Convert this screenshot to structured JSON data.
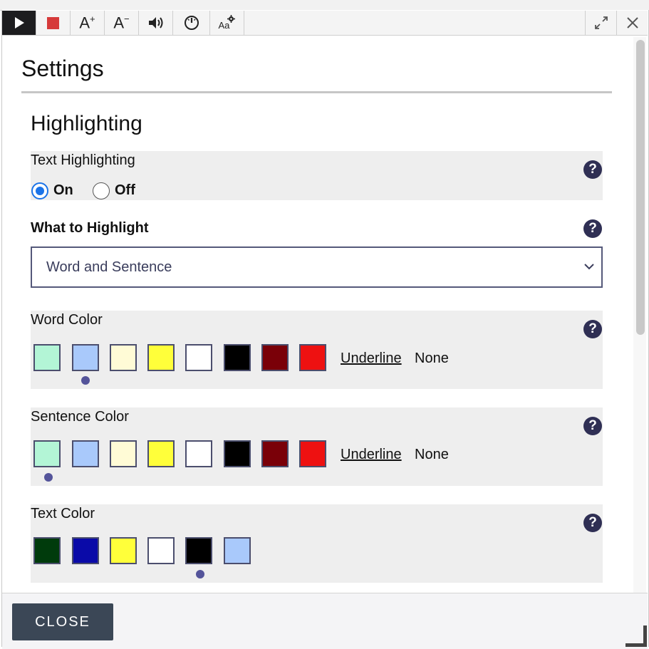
{
  "title": "Settings",
  "section": "Highlighting",
  "text_highlighting": {
    "label": "Text Highlighting",
    "options": [
      "On",
      "Off"
    ],
    "selected": "On"
  },
  "what_to_highlight": {
    "label": "What to Highlight",
    "value": "Word and Sentence"
  },
  "word_color": {
    "label": "Word Color",
    "swatches": [
      "#b3f5d6",
      "#a9c9fb",
      "#fffbd6",
      "#ffff3a",
      "#ffffff",
      "#000000",
      "#7a0008",
      "#ee1111"
    ],
    "selected_index": 1,
    "underline_label": "Underline",
    "none_label": "None"
  },
  "sentence_color": {
    "label": "Sentence Color",
    "swatches": [
      "#b3f5d6",
      "#a9c9fb",
      "#fffbd6",
      "#ffff3a",
      "#ffffff",
      "#000000",
      "#7a0008",
      "#ee1111"
    ],
    "selected_index": 0,
    "underline_label": "Underline",
    "none_label": "None"
  },
  "text_color": {
    "label": "Text Color",
    "swatches": [
      "#003b0c",
      "#0a0aa8",
      "#ffff3a",
      "#ffffff",
      "#000000",
      "#a9c9fb"
    ],
    "selected_index": 4
  },
  "close_label": "CLOSE",
  "toolbar": {
    "buttons": [
      "play-icon",
      "stop-icon",
      "font-increase-icon",
      "font-decrease-icon",
      "speaker-icon",
      "speed-icon",
      "text-settings-icon"
    ],
    "right_buttons": [
      "expand-icon",
      "close-icon"
    ],
    "increase_label": "A",
    "decrease_label": "A",
    "aa_label": "Aa"
  },
  "colors": {
    "accent_radio": "#1a73e8",
    "help_icon": "#2f2f54",
    "close_button": "#3b4756",
    "stop_button": "#d63a3a"
  }
}
